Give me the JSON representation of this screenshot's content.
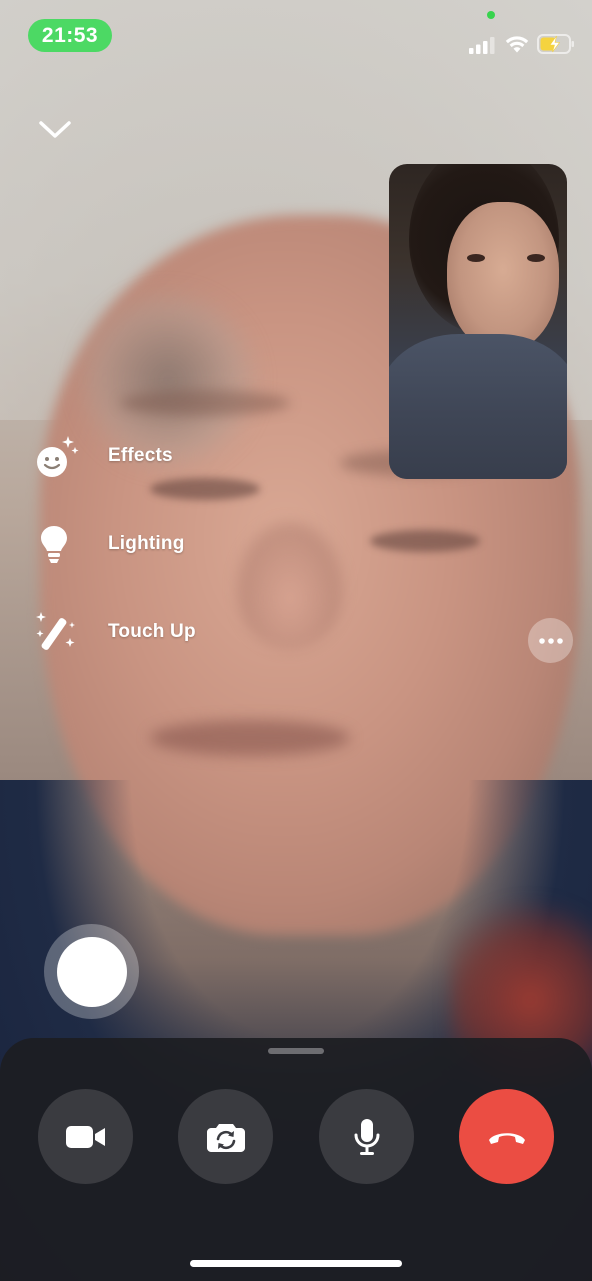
{
  "status_bar": {
    "time": "21:53",
    "icons": [
      "signal-icon",
      "wifi-icon",
      "battery-charging-icon"
    ],
    "time_pill_color": "#4cd964",
    "camera_indicator_color": "#38d34e"
  },
  "header": {
    "collapse_icon": "chevron-down-icon"
  },
  "effects_menu": {
    "items": [
      {
        "label": "Effects",
        "icon": "smiley-sparkle-icon"
      },
      {
        "label": "Lighting",
        "icon": "lightbulb-icon"
      },
      {
        "label": "Touch Up",
        "icon": "magic-wand-icon"
      }
    ]
  },
  "controls": {
    "more_icon": "ellipsis-icon",
    "shutter": "shutter-button",
    "buttons": [
      {
        "name": "video-toggle",
        "icon": "video-camera-icon"
      },
      {
        "name": "flip-camera",
        "icon": "camera-rotate-icon"
      },
      {
        "name": "mute",
        "icon": "microphone-icon"
      },
      {
        "name": "end-call",
        "icon": "hang-up-icon",
        "color": "#eb4d43"
      }
    ]
  }
}
